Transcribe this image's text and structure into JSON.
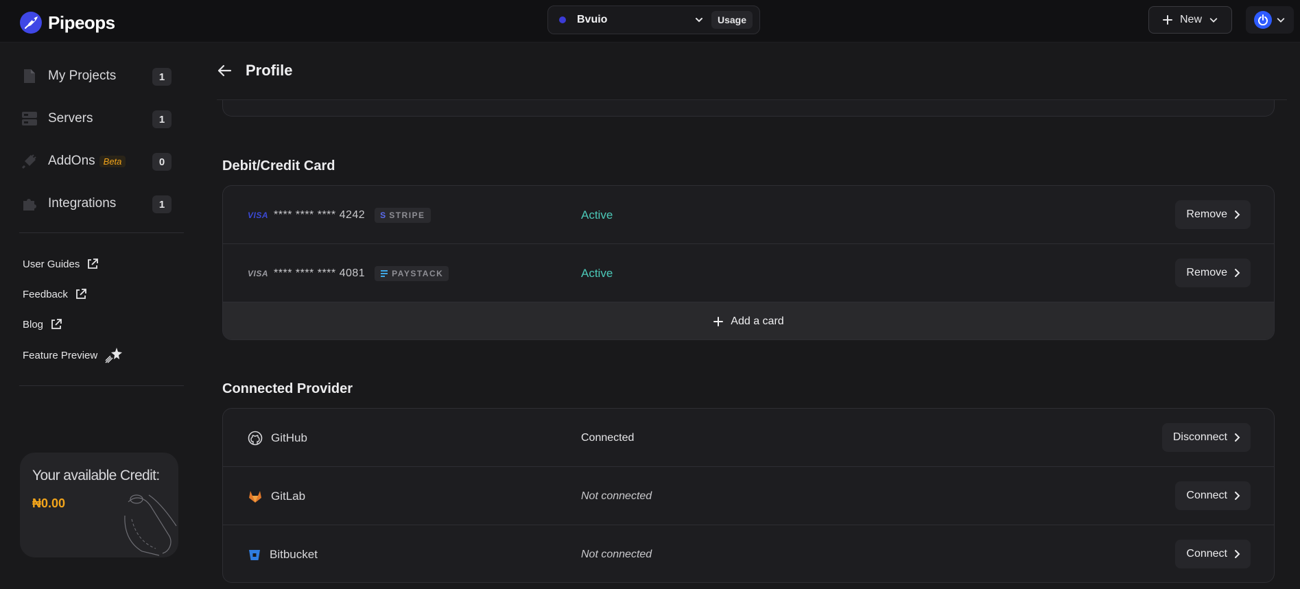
{
  "topbar": {
    "brand": "Pipeops",
    "workspace": {
      "name": "Bvuio",
      "usage_label": "Usage"
    },
    "new_label": "New"
  },
  "sidebar": {
    "items": [
      {
        "label": "My Projects",
        "count": "1",
        "icon": "file-icon"
      },
      {
        "label": "Servers",
        "count": "1",
        "icon": "server-icon"
      },
      {
        "label": "AddOns",
        "count": "0",
        "icon": "plug-icon",
        "badge": "Beta"
      },
      {
        "label": "Integrations",
        "count": "1",
        "icon": "puzzle-icon"
      }
    ],
    "links": [
      {
        "label": "User Guides",
        "icon": "external-link-icon"
      },
      {
        "label": "Feedback",
        "icon": "external-link-icon"
      },
      {
        "label": "Blog",
        "icon": "external-link-icon"
      },
      {
        "label": "Feature Preview",
        "icon": "sparkle-icon"
      }
    ],
    "credit": {
      "title": "Your available Credit:",
      "amount": "₦0.00"
    }
  },
  "main": {
    "title": "Profile",
    "cards_section": {
      "title": "Debit/Credit Card",
      "cards": [
        {
          "brand": "VISA",
          "masked": "**** **** **** 4242",
          "gateway": "STRIPE",
          "status": "Active",
          "action": "Remove"
        },
        {
          "brand": "VISA",
          "masked": "**** **** **** 4081",
          "gateway": "PAYSTACK",
          "status": "Active",
          "action": "Remove"
        }
      ],
      "add_label": "Add a card"
    },
    "providers_section": {
      "title": "Connected Provider",
      "providers": [
        {
          "name": "GitHub",
          "status": "Connected",
          "action": "Disconnect"
        },
        {
          "name": "GitLab",
          "status": "Not connected",
          "action": "Connect"
        },
        {
          "name": "Bitbucket",
          "status": "Not connected",
          "action": "Connect"
        }
      ]
    }
  },
  "colors": {
    "accent_orange": "#f3a51b",
    "active_teal": "#4cc9b8",
    "workspace_dot": "#3b3bd6"
  }
}
